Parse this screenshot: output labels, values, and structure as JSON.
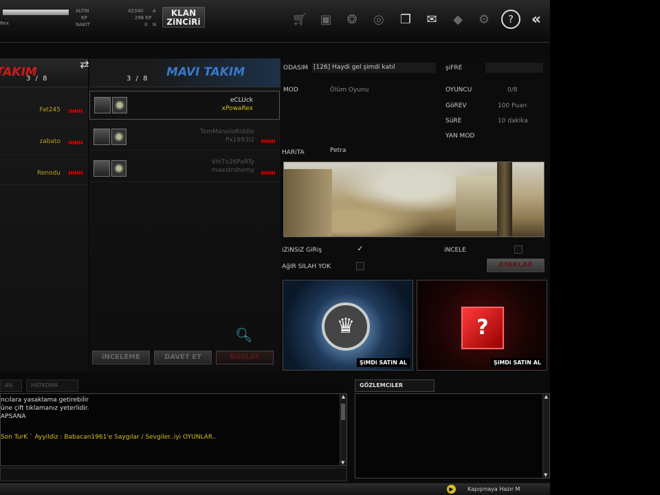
{
  "topbar": {
    "player_name": "Rex",
    "altin_label": "ALTIN",
    "kp_label": "KP",
    "nakit_label": "NAKIT",
    "altin_value": "42340",
    "altin_unit": "A",
    "kp_value": "296 KP",
    "nakit_value": "0",
    "nakit_unit": "N",
    "klan_line1": "KLAN",
    "klan_line2": "ZiNCiRi"
  },
  "red_team": {
    "name": "TAKIM",
    "count": "3 / 8",
    "players": [
      "Fat245",
      "zabato",
      "Renodu"
    ]
  },
  "blue_team": {
    "name": "MAVI TAKIM",
    "count": "3 / 8",
    "players": [
      {
        "line1": "eCLUck",
        "line2": "xPowaRex"
      },
      {
        "line1": "TomManoloRiddle",
        "line2": "Px1993I2"
      },
      {
        "line1": "VhiTx26PaRTy",
        "line2": "maestrohomy"
      }
    ]
  },
  "buttons": {
    "incele": "iNCELEME",
    "davet": "DAVET ET",
    "baslat": "BAŞLAT",
    "ayarlar": "AYARLAR"
  },
  "room": {
    "odasim_label": "ODASIM",
    "room_title": "[126] Haydi gel şimdi katıl",
    "sifre_label": "şiFRE",
    "mod_label": "MOD",
    "mod_value": "Ölüm Oyunu",
    "oyuncu_label": "OYUNCU",
    "oyuncu_value": "0/8",
    "gorev_label": "GöREV",
    "gorev_value": "100 Puan",
    "sure_label": "SüRE",
    "sure_value": "10 dakika",
    "yanmod_label": "YAN MOD",
    "harita_label": "HARiTA",
    "harita_value": "Petra",
    "izinsiz_label": "iZiNSiZ GiRiş",
    "agir_label": "AğIR SILAH YOK",
    "incele_label": "iNCELE",
    "promo_buy": "ŞiMDi SATIN AL"
  },
  "chat": {
    "tab1": "AN",
    "tab2": "HATKOMA",
    "lines": [
      "ncılara yasaklama getirebilir",
      "üne çift tıklamanız yeterlidir.",
      "APSANA",
      "Son TurK ` Ayyildiz : Babacan1961'e Saygılar / Sevgiler..iyi OYUNLAR.."
    ],
    "observers_title": "GÖZLEMCiLER"
  },
  "status": {
    "text": "Kapışmaya Hazır M"
  },
  "colors": {
    "red": "#d01818",
    "blue": "#3a78c8",
    "yellow": "#d8c020"
  }
}
